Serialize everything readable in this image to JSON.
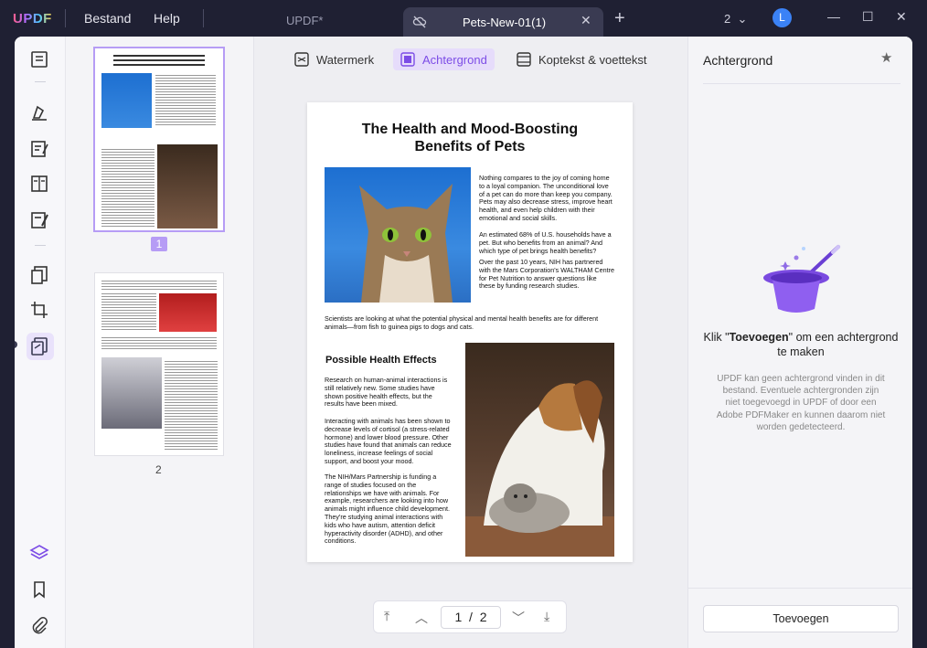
{
  "app": {
    "logo": "UPDF",
    "menu": [
      "Bestand",
      "Help"
    ],
    "tabs": {
      "inactive": "UPDF*",
      "active": "Pets-New-01(1)"
    },
    "window_count": "2",
    "avatar_letter": "L"
  },
  "toolbar": {
    "watermark": "Watermerk",
    "background": "Achtergrond",
    "header_footer": "Koptekst & voettekst"
  },
  "thumbnails": {
    "page1": "1",
    "page2": "2"
  },
  "document": {
    "title_line1": "The Health and Mood-Boosting",
    "title_line2": "Benefits of Pets",
    "intro1": "Nothing compares to the joy of coming home to a loyal companion. The unconditional love of a pet can do more than keep you company. Pets may also decrease stress, improve heart health, and even help children with their emotional and social skills.",
    "intro2": "An estimated 68% of U.S. households have a pet. But who benefits from an animal? And which type of pet brings health benefits?",
    "intro3": "Over the past 10 years, NIH has partnered with the Mars Corporation's WALTHAM Centre for Pet Nutrition to answer questions like these by funding research studies.",
    "scientists": "Scientists are looking at what the potential physical and mental health benefits are for different animals—from fish to guinea pigs to dogs and cats.",
    "section_heading": "Possible Health Effects",
    "effects1": "Research on human-animal interactions is still relatively new. Some studies have shown positive health effects, but the results have been mixed.",
    "effects2": "Interacting with animals has been shown to decrease levels of cortisol (a stress-related hormone) and lower blood pressure. Other studies have found that animals can reduce loneliness, increase feelings of social support, and boost your mood.",
    "effects3": "The NIH/Mars Partnership is funding a range of studies focused on the relationships we have with animals. For example, researchers are looking into how animals might influence child development. They're studying animal interactions with kids who have autism, attention deficit hyperactivity disorder (ADHD), and other conditions."
  },
  "pager": {
    "current": "1",
    "separator": "/",
    "total": "2"
  },
  "panel": {
    "title": "Achtergrond",
    "heading_prefix": "Klik \"",
    "heading_bold": "Toevoegen",
    "heading_suffix": "\" om een achtergrond te maken",
    "description": "UPDF kan geen achtergrond vinden in dit bestand. Eventuele achtergronden zijn niet toegevoegd in UPDF of door een Adobe PDFMaker en kunnen daarom niet worden gedetecteerd.",
    "add_button": "Toevoegen"
  },
  "colors": {
    "accent": "#7c4ce6",
    "accent_light": "#e6dcfb",
    "titlebar": "#1f2033"
  }
}
